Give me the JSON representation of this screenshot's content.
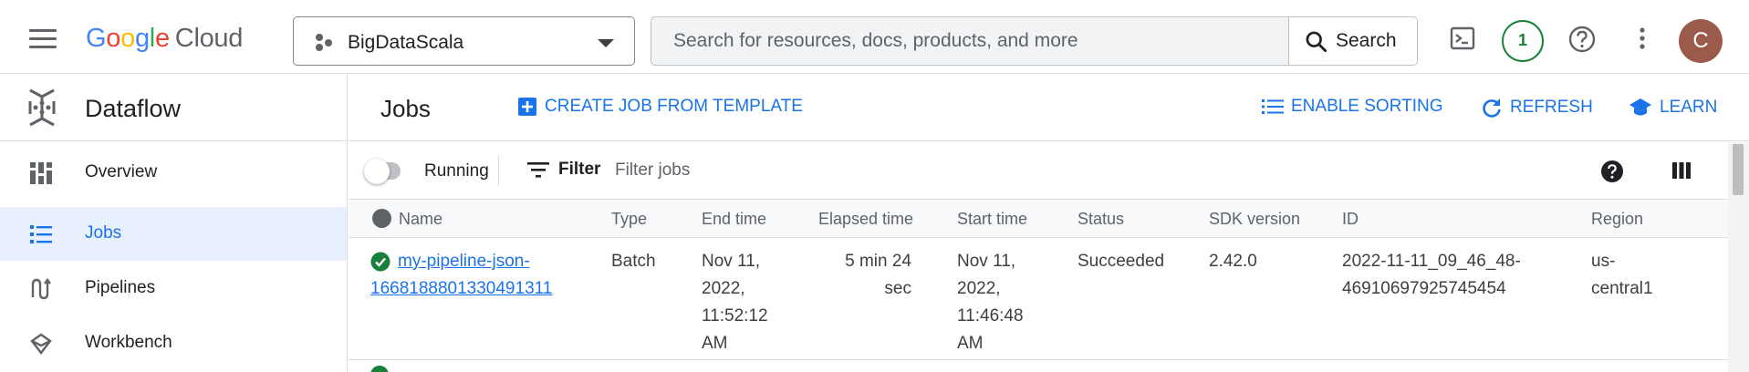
{
  "header": {
    "brand": {
      "google_letters": [
        "G",
        "o",
        "o",
        "g",
        "l",
        "e"
      ],
      "product": "Cloud"
    },
    "project": {
      "name": "BigDataScala"
    },
    "search": {
      "placeholder": "Search for resources, docs, products, and more",
      "button_label": "Search"
    },
    "notifications_count": "1",
    "avatar_initial": "C"
  },
  "sidebar": {
    "title": "Dataflow",
    "items": [
      {
        "label": "Overview",
        "icon": "overview-icon",
        "active": false
      },
      {
        "label": "Jobs",
        "icon": "list-icon",
        "active": true
      },
      {
        "label": "Pipelines",
        "icon": "pipelines-icon",
        "active": false
      },
      {
        "label": "Workbench",
        "icon": "workbench-icon",
        "active": false
      }
    ]
  },
  "main": {
    "title": "Jobs",
    "actions": {
      "create_job": "CREATE JOB FROM TEMPLATE",
      "enable_sorting": "ENABLE SORTING",
      "refresh": "REFRESH",
      "learn": "LEARN"
    },
    "toolbar": {
      "running_label": "Running",
      "filter_label": "Filter",
      "filter_placeholder": "Filter jobs"
    },
    "table": {
      "columns": [
        "Name",
        "Type",
        "End time",
        "Elapsed time",
        "Start time",
        "Status",
        "SDK version",
        "ID",
        "Region"
      ],
      "rows": [
        {
          "name_line1": "my-pipeline-json-",
          "name_line2": "1668188801330491311",
          "type": "Batch",
          "end_time": [
            "Nov 11,",
            "2022,",
            "11:52:12",
            "AM"
          ],
          "elapsed": [
            "5 min 24",
            "sec"
          ],
          "start_time": [
            "Nov 11,",
            "2022,",
            "11:46:48",
            "AM"
          ],
          "status": "Succeeded",
          "sdk_version": "2.42.0",
          "id": [
            "2022-11-11_09_46_48-",
            "46910697925745454"
          ],
          "region": [
            "us-",
            "central1"
          ]
        }
      ]
    }
  },
  "colors": {
    "accent": "#1a73e8",
    "success": "#188038",
    "active_bg": "#e8f0fe",
    "avatar_bg": "#9a5b4b"
  }
}
